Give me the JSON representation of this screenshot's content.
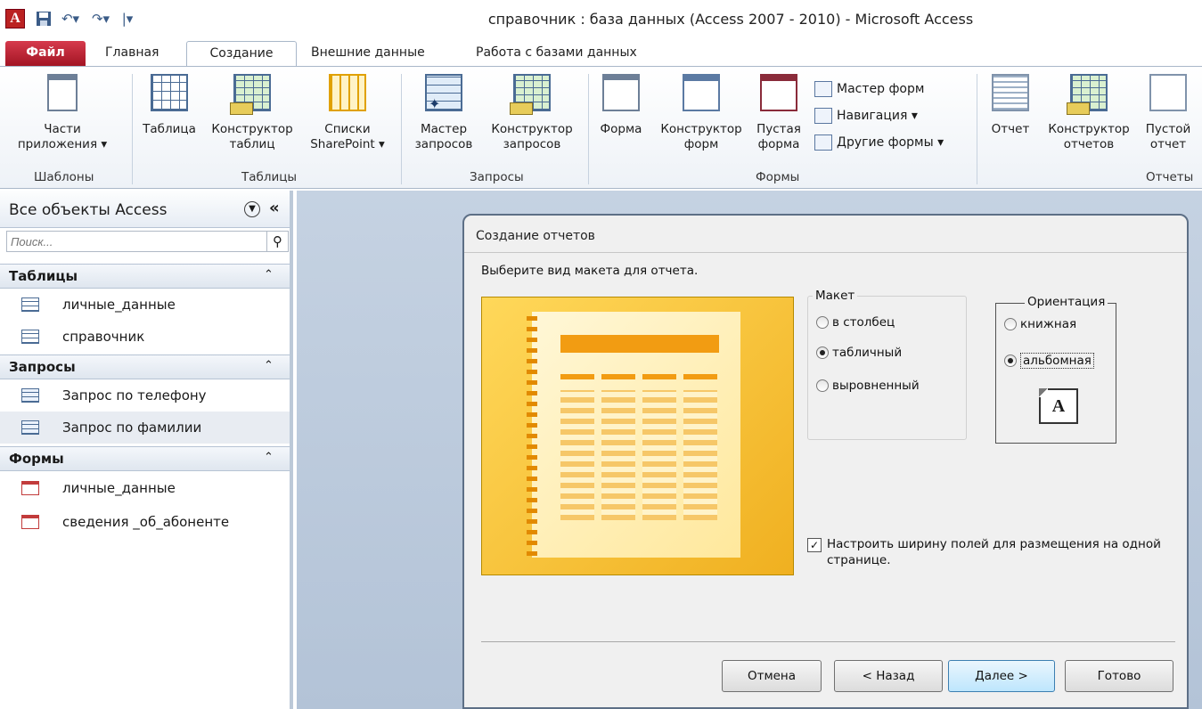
{
  "window": {
    "title": "справочник : база данных (Access 2007 - 2010)  -  Microsoft Access",
    "app_icon": "A"
  },
  "tabs": [
    "Файл",
    "Главная",
    "Создание",
    "Внешние данные",
    "Работа с базами данных"
  ],
  "ribbon": {
    "templates": {
      "btn_label": "Части приложения ▾",
      "group": "Шаблоны"
    },
    "tables": {
      "table": "Таблица",
      "designer": "Конструктор таблиц",
      "sharepoint": "Списки SharePoint ▾",
      "group": "Таблицы"
    },
    "queries": {
      "wizard": "Мастер запросов",
      "designer": "Конструктор запросов",
      "group": "Запросы"
    },
    "forms": {
      "form": "Форма",
      "designer": "Конструктор форм",
      "blank": "Пустая форма",
      "wizard": "Мастер форм",
      "navigation": "Навигация ▾",
      "other": "Другие формы ▾",
      "group": "Формы"
    },
    "reports": {
      "report": "Отчет",
      "designer": "Конструктор отчетов",
      "blank": "Пустой отчет",
      "group": "Отчеты"
    }
  },
  "nav": {
    "title": "Все объекты Access",
    "search_placeholder": "Поиск...",
    "groups": [
      {
        "label": "Таблицы",
        "items": [
          "личные_данные",
          "справочник"
        ]
      },
      {
        "label": "Запросы",
        "items": [
          "Запрос по телефону",
          "Запрос по фамилии"
        ]
      },
      {
        "label": "Формы",
        "items": [
          "личные_данные",
          "сведения _об_абоненте"
        ]
      }
    ]
  },
  "dialog": {
    "title": "Создание отчетов",
    "prompt": "Выберите вид макета для отчета.",
    "layout": {
      "legend": "Макет",
      "options": [
        "в столбец",
        "табличный",
        "выровненный"
      ],
      "selected": "табличный"
    },
    "orientation": {
      "legend": "Ориентация",
      "options": [
        "книжная",
        "альбомная"
      ],
      "selected": "альбомная",
      "icon_letter": "A"
    },
    "fit_checkbox": {
      "checked": true,
      "label": "Настроить ширину полей для размещения на одной странице."
    },
    "buttons": {
      "cancel": "Отмена",
      "back": "< Назад",
      "next": "Далее >",
      "finish": "Готово"
    }
  }
}
